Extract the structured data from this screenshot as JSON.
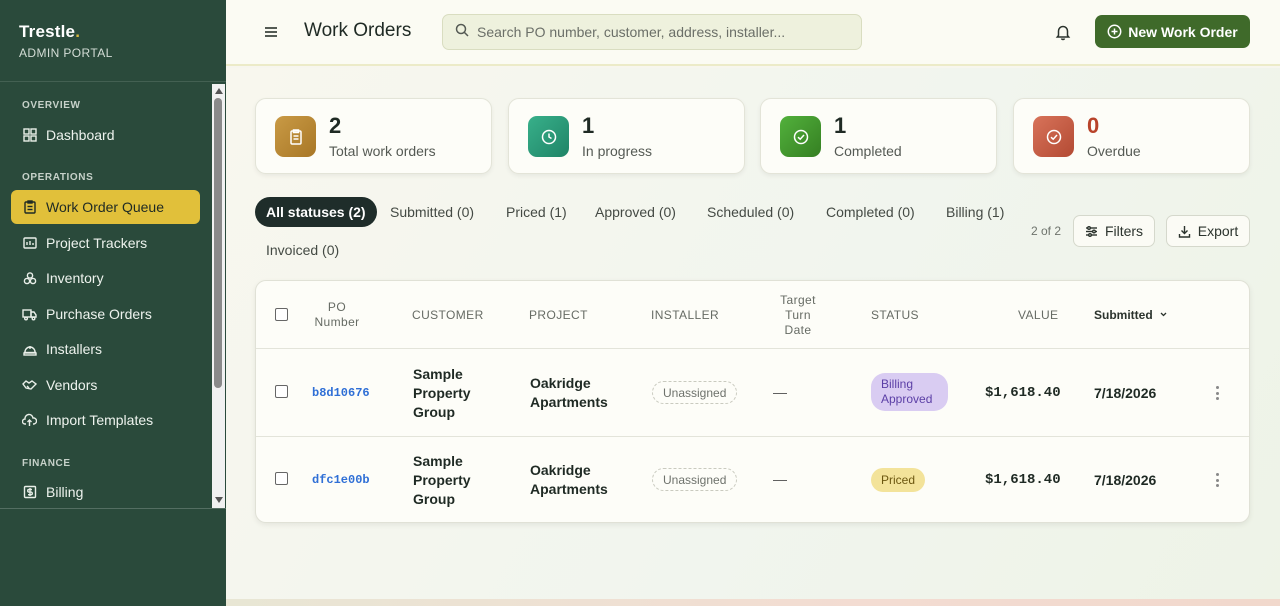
{
  "brand": {
    "name": "Trestle",
    "dot": ".",
    "subtitle": "ADMIN PORTAL"
  },
  "sidebar": {
    "sections": [
      {
        "title": "OVERVIEW"
      },
      {
        "title": "OPERATIONS"
      },
      {
        "title": "FINANCE"
      }
    ],
    "items": [
      {
        "label": "Dashboard",
        "icon": "dashboard-icon"
      },
      {
        "label": "Work Order Queue",
        "icon": "clipboard-icon",
        "active": true
      },
      {
        "label": "Project Trackers",
        "icon": "tracker-icon"
      },
      {
        "label": "Inventory",
        "icon": "boxes-icon"
      },
      {
        "label": "Purchase Orders",
        "icon": "truck-icon"
      },
      {
        "label": "Installers",
        "icon": "hardhat-icon"
      },
      {
        "label": "Vendors",
        "icon": "handshake-icon"
      },
      {
        "label": "Import Templates",
        "icon": "cloud-upload-icon"
      },
      {
        "label": "Billing",
        "icon": "dollar-icon"
      }
    ]
  },
  "header": {
    "title": "Work Orders",
    "search_placeholder": "Search PO number, customer, address, installer...",
    "new_button": "New Work Order"
  },
  "stats": [
    {
      "value": "2",
      "label": "Total work orders",
      "color": "#b98a36",
      "icon": "clipboard-icon"
    },
    {
      "value": "1",
      "label": "In progress",
      "color": "#2a9a78",
      "icon": "clock-icon"
    },
    {
      "value": "1",
      "label": "Completed",
      "color": "#3f9a2e",
      "icon": "check-circle-icon"
    },
    {
      "value": "0",
      "label": "Overdue",
      "color": "#c9573f",
      "icon": "alert-circle-icon",
      "value_color": "#b8432a"
    }
  ],
  "tabs": [
    {
      "label": "All statuses (2)",
      "active": true
    },
    {
      "label": "Submitted (0)"
    },
    {
      "label": "Priced (1)"
    },
    {
      "label": "Approved (0)"
    },
    {
      "label": "Scheduled (0)"
    },
    {
      "label": "Completed (0)"
    },
    {
      "label": "Billing (1)"
    },
    {
      "label": "Invoiced (0)"
    }
  ],
  "count_note": "2 of 2",
  "tools": {
    "filters": "Filters",
    "export": "Export"
  },
  "table": {
    "columns": {
      "po": "PO Number",
      "customer": "CUSTOMER",
      "project": "PROJECT",
      "installer": "INSTALLER",
      "target": "Target Turn Date",
      "status": "STATUS",
      "value": "VALUE",
      "submitted": "Submitted"
    },
    "rows": [
      {
        "po": "b8d10676",
        "customer": "Sample Property Group",
        "project": "Oakridge Apartments",
        "installer": "Unassigned",
        "target": "—",
        "status": "Billing Approved",
        "status_bg": "#d9ccf2",
        "status_fg": "#5b3fa6",
        "value": "$1,618.40",
        "submitted": "7/18/2026"
      },
      {
        "po": "dfc1e00b",
        "customer": "Sample Property Group",
        "project": "Oakridge Apartments",
        "installer": "Unassigned",
        "target": "—",
        "status": "Priced",
        "status_bg": "#f3e39a",
        "status_fg": "#6c5710",
        "value": "$1,618.40",
        "submitted": "7/18/2026"
      }
    ]
  }
}
